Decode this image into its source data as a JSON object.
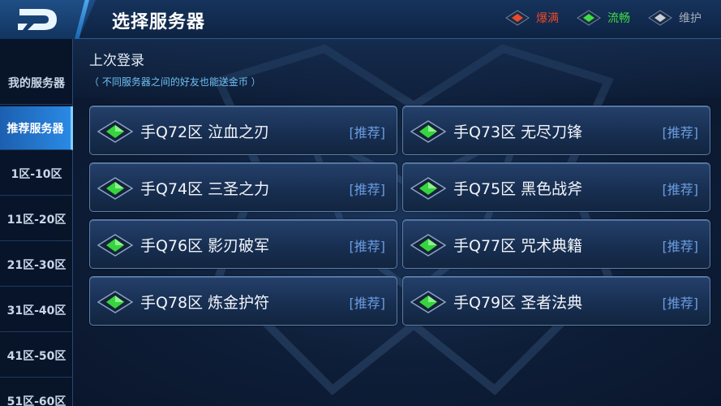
{
  "header": {
    "title": "选择服务器",
    "back_icon": "back-d-icon"
  },
  "legend": [
    {
      "label": "爆满",
      "color": "#e8482c",
      "icon": "gem-red-icon"
    },
    {
      "label": "流畅",
      "color": "#3fdc46",
      "icon": "gem-green-icon"
    },
    {
      "label": "维护",
      "color": "#a3acba",
      "icon": "gem-gray-icon"
    }
  ],
  "sidebar": {
    "items": [
      {
        "label": "我的服务器",
        "active": false
      },
      {
        "label": "推荐服务器",
        "active": true
      },
      {
        "label": "1区-10区",
        "active": false
      },
      {
        "label": "11区-20区",
        "active": false
      },
      {
        "label": "21区-30区",
        "active": false
      },
      {
        "label": "31区-40区",
        "active": false
      },
      {
        "label": "41区-50区",
        "active": false
      },
      {
        "label": "51区-60区",
        "active": false
      }
    ]
  },
  "main": {
    "last_login": "上次登录",
    "note": "（ 不同服务器之间的好友也能送金币 ）",
    "servers": [
      {
        "name": "手Q72区 泣血之刃",
        "tag": "[推荐]",
        "status": "smooth"
      },
      {
        "name": "手Q73区 无尽刀锋",
        "tag": "[推荐]",
        "status": "smooth"
      },
      {
        "name": "手Q74区 三圣之力",
        "tag": "[推荐]",
        "status": "smooth"
      },
      {
        "name": "手Q75区 黑色战斧",
        "tag": "[推荐]",
        "status": "smooth"
      },
      {
        "name": "手Q76区 影刃破军",
        "tag": "[推荐]",
        "status": "smooth"
      },
      {
        "name": "手Q77区 咒术典籍",
        "tag": "[推荐]",
        "status": "smooth"
      },
      {
        "name": "手Q78区 炼金护符",
        "tag": "[推荐]",
        "status": "smooth"
      },
      {
        "name": "手Q79区 圣者法典",
        "tag": "[推荐]",
        "status": "smooth"
      }
    ]
  }
}
